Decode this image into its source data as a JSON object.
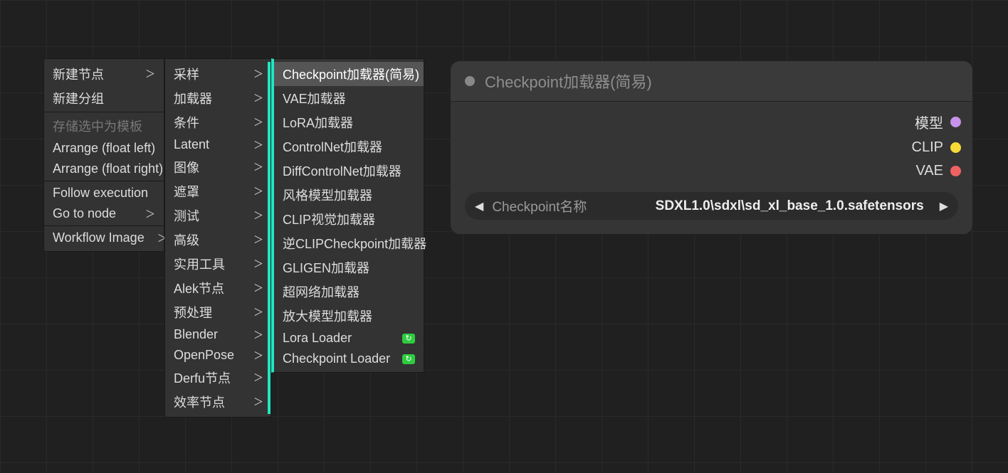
{
  "menu1": {
    "items": [
      {
        "label": "新建节点",
        "chev": true
      },
      {
        "label": "新建分组",
        "chev": false
      }
    ],
    "items2": [
      {
        "label": "存储选中为模板",
        "disabled": true,
        "chev": false
      },
      {
        "label": "Arrange (float left)",
        "chev": false
      },
      {
        "label": "Arrange (float right)",
        "chev": false
      }
    ],
    "items3": [
      {
        "label": "Follow execution",
        "chev": false
      },
      {
        "label": "Go to node",
        "chev": true
      }
    ],
    "items4": [
      {
        "label": "Workflow Image",
        "chev": true
      }
    ]
  },
  "menu2": {
    "items": [
      {
        "label": "采样",
        "chev": true
      },
      {
        "label": "加载器",
        "chev": true
      },
      {
        "label": "条件",
        "chev": true
      },
      {
        "label": "Latent",
        "chev": true
      },
      {
        "label": "图像",
        "chev": true
      },
      {
        "label": "遮罩",
        "chev": true
      },
      {
        "label": "测试",
        "chev": true
      },
      {
        "label": "高级",
        "chev": true
      },
      {
        "label": "实用工具",
        "chev": true
      },
      {
        "label": "Alek节点",
        "chev": true
      },
      {
        "label": "预处理",
        "chev": true
      },
      {
        "label": "Blender",
        "chev": true
      },
      {
        "label": "OpenPose",
        "chev": true
      },
      {
        "label": "Derfu节点",
        "chev": true
      },
      {
        "label": "效率节点",
        "chev": true
      }
    ]
  },
  "menu3": {
    "items": [
      {
        "label": "Checkpoint加载器(简易)",
        "selected": true
      },
      {
        "label": "VAE加载器"
      },
      {
        "label": "LoRA加载器"
      },
      {
        "label": "ControlNet加载器"
      },
      {
        "label": "DiffControlNet加载器"
      },
      {
        "label": "风格模型加载器"
      },
      {
        "label": "CLIP视觉加载器"
      },
      {
        "label": "逆CLIPCheckpoint加载器"
      },
      {
        "label": "GLIGEN加载器"
      },
      {
        "label": "超网络加载器"
      },
      {
        "label": "放大模型加载器"
      },
      {
        "label": "Lora Loader",
        "badge": true
      },
      {
        "label": "Checkpoint Loader",
        "badge": true
      }
    ]
  },
  "node": {
    "title": "Checkpoint加载器(简易)",
    "outputs": [
      {
        "label": "模型",
        "color": "purple"
      },
      {
        "label": "CLIP",
        "color": "yellow"
      },
      {
        "label": "VAE",
        "color": "red"
      }
    ],
    "widget": {
      "label": "Checkpoint名称",
      "value": "SDXL1.0\\sdxl\\sd_xl_base_1.0.safetensors"
    }
  }
}
